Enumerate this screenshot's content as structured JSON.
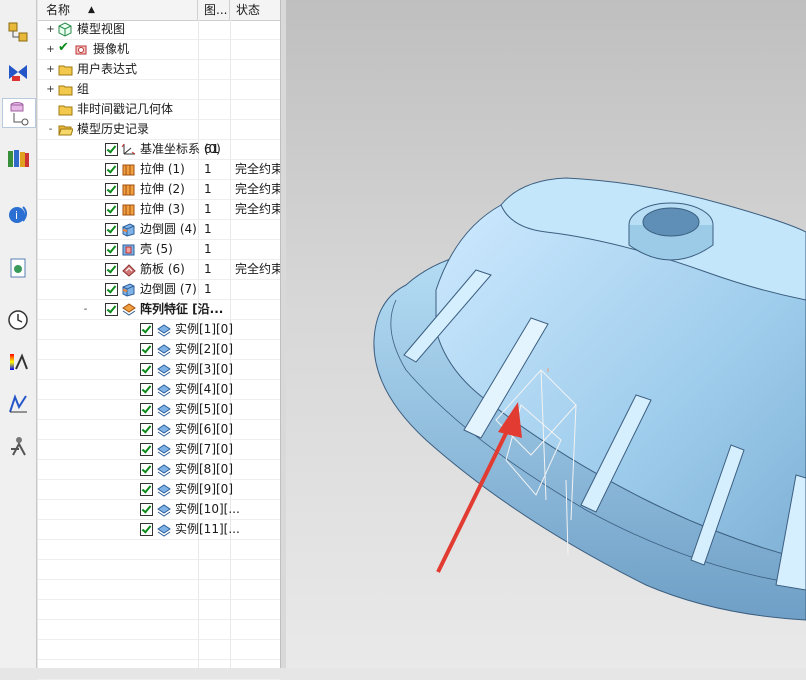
{
  "navigator": {
    "columns": {
      "name": "名称",
      "figure": "图...",
      "status": "状态"
    },
    "rows": [
      {
        "label": "模型视图",
        "fig": "",
        "status": "",
        "level": 0,
        "expand": "+",
        "check": false,
        "icon": "model-view-icon"
      },
      {
        "label": "摄像机",
        "fig": "",
        "status": "",
        "level": 0,
        "expand": "+",
        "check": false,
        "icon": "camera-icon"
      },
      {
        "label": "用户表达式",
        "fig": "",
        "status": "",
        "level": 0,
        "expand": "+",
        "check": false,
        "icon": "folder-icon"
      },
      {
        "label": "组",
        "fig": "",
        "status": "",
        "level": 0,
        "expand": "+",
        "check": false,
        "icon": "folder-icon"
      },
      {
        "label": "非时间戳记几何体",
        "fig": "",
        "status": "",
        "level": 0,
        "expand": "",
        "check": false,
        "icon": "folder-icon"
      },
      {
        "label": "模型历史记录",
        "fig": "",
        "status": "",
        "level": 0,
        "expand": "-",
        "check": false,
        "icon": "folder-open-icon"
      },
      {
        "label": "基准坐标系 (0)",
        "fig": "61",
        "status": "",
        "level": 1,
        "expand": "",
        "check": true,
        "icon": "datum-csys-icon"
      },
      {
        "label": "拉伸 (1)",
        "fig": "1",
        "status": "完全约束",
        "level": 1,
        "expand": "",
        "check": true,
        "icon": "extrude-icon"
      },
      {
        "label": "拉伸 (2)",
        "fig": "1",
        "status": "完全约束",
        "level": 1,
        "expand": "",
        "check": true,
        "icon": "extrude-icon"
      },
      {
        "label": "拉伸 (3)",
        "fig": "1",
        "status": "完全约束",
        "level": 1,
        "expand": "",
        "check": true,
        "icon": "extrude-icon"
      },
      {
        "label": "边倒圆 (4)",
        "fig": "1",
        "status": "",
        "level": 1,
        "expand": "",
        "check": true,
        "icon": "edge-blend-icon"
      },
      {
        "label": "壳 (5)",
        "fig": "1",
        "status": "",
        "level": 1,
        "expand": "",
        "check": true,
        "icon": "shell-icon"
      },
      {
        "label": "筋板 (6)",
        "fig": "1",
        "status": "完全约束",
        "level": 1,
        "expand": "",
        "check": true,
        "icon": "rib-icon"
      },
      {
        "label": "边倒圆 (7)",
        "fig": "1",
        "status": "",
        "level": 1,
        "expand": "",
        "check": true,
        "icon": "edge-blend-icon"
      },
      {
        "label": "阵列特征 [沿...",
        "fig": "",
        "status": "",
        "level": 1,
        "expand": "-",
        "check": true,
        "icon": "pattern-feature-icon",
        "bold": true
      },
      {
        "label": "实例[1][0]",
        "fig": "",
        "status": "",
        "level": 2,
        "expand": "",
        "check": true,
        "icon": "instance-icon"
      },
      {
        "label": "实例[2][0]",
        "fig": "",
        "status": "",
        "level": 2,
        "expand": "",
        "check": true,
        "icon": "instance-icon"
      },
      {
        "label": "实例[3][0]",
        "fig": "",
        "status": "",
        "level": 2,
        "expand": "",
        "check": true,
        "icon": "instance-icon"
      },
      {
        "label": "实例[4][0]",
        "fig": "",
        "status": "",
        "level": 2,
        "expand": "",
        "check": true,
        "icon": "instance-icon"
      },
      {
        "label": "实例[5][0]",
        "fig": "",
        "status": "",
        "level": 2,
        "expand": "",
        "check": true,
        "icon": "instance-icon"
      },
      {
        "label": "实例[6][0]",
        "fig": "",
        "status": "",
        "level": 2,
        "expand": "",
        "check": true,
        "icon": "instance-icon"
      },
      {
        "label": "实例[7][0]",
        "fig": "",
        "status": "",
        "level": 2,
        "expand": "",
        "check": true,
        "icon": "instance-icon"
      },
      {
        "label": "实例[8][0]",
        "fig": "",
        "status": "",
        "level": 2,
        "expand": "",
        "check": true,
        "icon": "instance-icon"
      },
      {
        "label": "实例[9][0]",
        "fig": "",
        "status": "",
        "level": 2,
        "expand": "",
        "check": true,
        "icon": "instance-icon"
      },
      {
        "label": "实例[10][...",
        "fig": "",
        "status": "",
        "level": 2,
        "expand": "",
        "check": true,
        "icon": "instance-icon"
      },
      {
        "label": "实例[11][...",
        "fig": "",
        "status": "",
        "level": 2,
        "expand": "",
        "check": true,
        "icon": "instance-icon"
      }
    ]
  },
  "toolbar_icons": [
    "assembly-navigator-icon",
    "constraint-navigator-icon",
    "part-navigator-icon",
    "reuse-library-icon",
    "web-browser-icon",
    "document-icon",
    "history-icon",
    "palette-icon",
    "analysis-icon",
    "roles-icon"
  ],
  "colors": {
    "part": "#a8d4ef",
    "arrow": "#e23b32",
    "check": "#0b8a1a",
    "folder": "#f2c94c"
  }
}
